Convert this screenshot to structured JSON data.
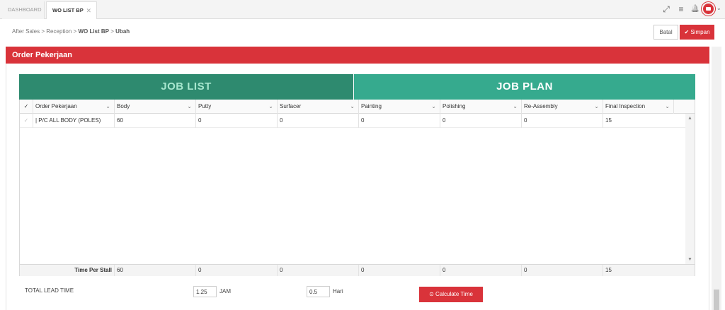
{
  "tabs": [
    {
      "label": "DASHBOARD"
    },
    {
      "label": "WO LIST BP",
      "close": "✕"
    }
  ],
  "toolbar": {
    "expand_icon": "⤢",
    "menu_icon": "≡",
    "bell_icon": "🔔",
    "caret": "⌄"
  },
  "breadcrumb": {
    "items": [
      "After Sales",
      "Reception",
      "WO List BP",
      "Ubah"
    ],
    "sep": ">"
  },
  "actions": {
    "cancel_label": "Batal",
    "save_label": "Simpan",
    "save_icon": "✔"
  },
  "panel": {
    "title": "Order Pekerjaan"
  },
  "grid": {
    "banner_job": "JOB LIST",
    "banner_plan": "JOB PLAN",
    "columns": [
      "Order Pekerjaan",
      "Body",
      "Putty",
      "Surfacer",
      "Painting",
      "Polishing",
      "Re-Assembly",
      "Final Inspection"
    ],
    "rows": [
      [
        "| P/C ALL BODY (POLES)",
        "60",
        "0",
        "0",
        "0",
        "0",
        "0",
        "15"
      ]
    ],
    "footer": [
      "Time Per Stall",
      "60",
      "0",
      "0",
      "0",
      "0",
      "0",
      "15"
    ],
    "check_icon": "✓",
    "caret": "⌄",
    "scroll_up": "▲",
    "scroll_down": "▼"
  },
  "lead_time": {
    "label": "TOTAL LEAD TIME",
    "jam_value": "1.25",
    "jam_unit": "JAM",
    "hari_value": "0.5",
    "hari_unit": "Hari",
    "calc_label": "Calculate Time",
    "calc_icon": "⊙"
  }
}
